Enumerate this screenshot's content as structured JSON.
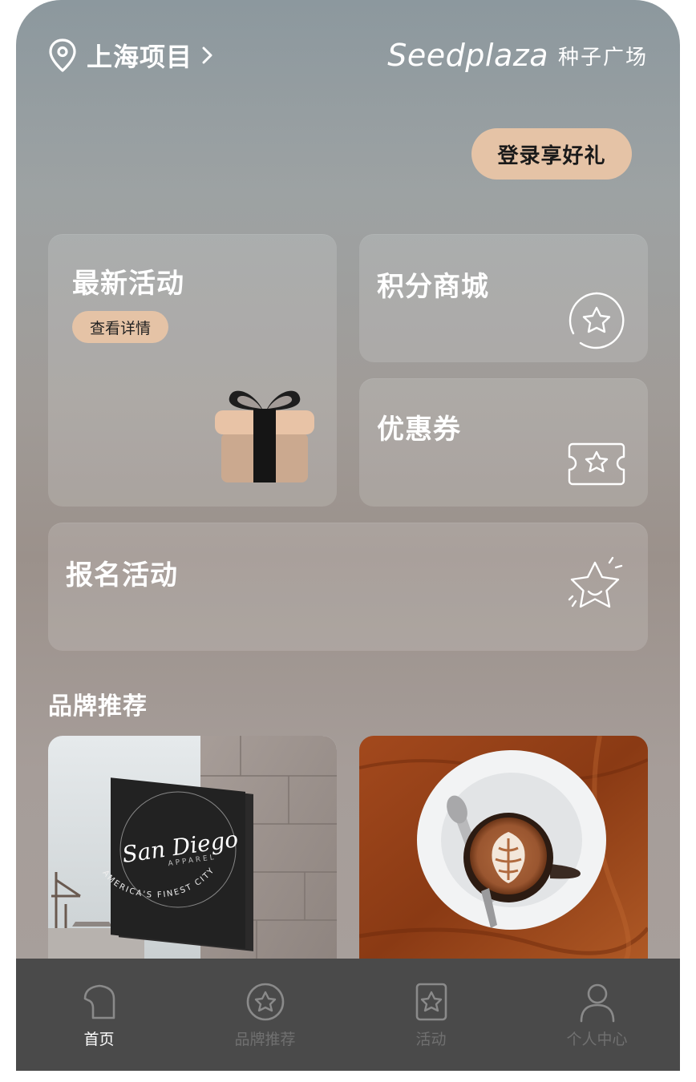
{
  "header": {
    "location": "上海项目",
    "location_icon": "location-pin-icon",
    "chevron_icon": "chevron-right-icon",
    "brand_en": "Seedplaza",
    "brand_cn": "种子广场"
  },
  "login_button": "登录享好礼",
  "cards": {
    "latest": {
      "title": "最新活动",
      "action": "查看详情",
      "icon": "gift-icon"
    },
    "points": {
      "title": "积分商城",
      "icon": "star-badge-icon"
    },
    "coupon": {
      "title": "优惠券",
      "icon": "coupon-ticket-icon"
    },
    "signup": {
      "title": "报名活动",
      "icon": "sparkle-star-icon"
    }
  },
  "brand_section": {
    "title": "品牌推荐",
    "items": [
      {
        "sign_title": "San Diego",
        "sign_sub": "APPAREL",
        "sign_ring": "AMERICA'S FINEST CITY"
      },
      {
        "image": "latte-art-coffee-image"
      }
    ]
  },
  "tabbar": [
    {
      "label": "首页",
      "icon": "home-icon",
      "active": true
    },
    {
      "label": "品牌推荐",
      "icon": "brand-badge-icon",
      "active": false
    },
    {
      "label": "活动",
      "icon": "activity-card-icon",
      "active": false
    },
    {
      "label": "个人中心",
      "icon": "user-icon",
      "active": false
    }
  ],
  "colors": {
    "accent": "#e5c3a6",
    "tabbar_bg": "#4a4a4a",
    "tab_active": "#ffffff",
    "tab_inactive": "#707070"
  }
}
